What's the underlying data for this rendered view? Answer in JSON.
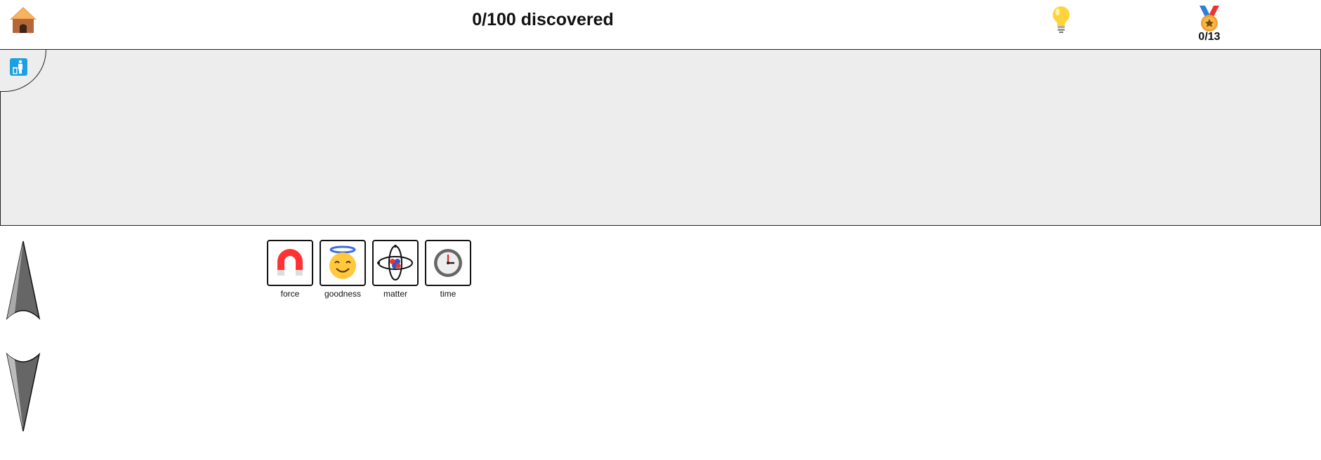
{
  "header": {
    "discovered_text": "0/100 discovered",
    "achievements_count": "0/13",
    "icons": {
      "home": "home-hut-icon",
      "hint": "lightbulb-icon",
      "achievements": "medal-icon"
    }
  },
  "workspace": {
    "trash_icon": "trash-person-icon",
    "background": "#ededed"
  },
  "scroll": {
    "up_icon": "arrow-up-icon",
    "down_icon": "arrow-down-icon"
  },
  "elements": [
    {
      "label": "force",
      "icon": "magnet-icon"
    },
    {
      "label": "goodness",
      "icon": "angel-face-icon"
    },
    {
      "label": "matter",
      "icon": "atom-icon"
    },
    {
      "label": "time",
      "icon": "clock-icon"
    }
  ],
  "colors": {
    "accent_blue": "#1ba1e2",
    "magnet_red": "#f33",
    "face_yellow": "#ffc83d"
  }
}
